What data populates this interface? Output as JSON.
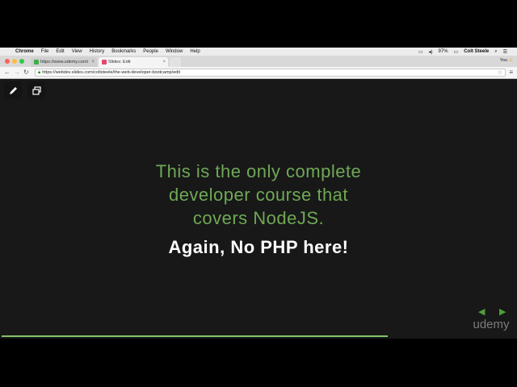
{
  "menubar": {
    "app": "Chrome",
    "items": [
      "File",
      "Edit",
      "View",
      "History",
      "Bookmarks",
      "People",
      "Window",
      "Help"
    ],
    "battery": "97%",
    "user": "Colt Steele"
  },
  "tabs": [
    {
      "title": "https://www.udemy.com/"
    },
    {
      "title": "Slides: Edit"
    }
  ],
  "profile": "You",
  "address": {
    "url": "https://webdev.slides.com/coltsteele/the-web-developer-bootcamp/edit"
  },
  "slide": {
    "lines": [
      "This is the only complete",
      "developer course that",
      "covers NodeJS."
    ],
    "emphasis": "Again, No PHP here!"
  },
  "watermark": {
    "brand": "udemy"
  },
  "colors": {
    "accent_green": "#6fa856",
    "background": "#181818",
    "progress": "#84c26a"
  },
  "icons": {
    "tool1": "pen-icon",
    "tool2": "fullscreen-icon"
  }
}
